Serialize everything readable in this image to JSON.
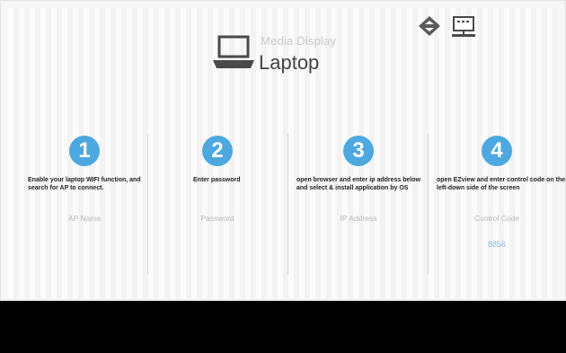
{
  "header": {
    "subtitle": "Media Display",
    "title": "Laptop",
    "icons": {
      "laptop": "laptop-icon",
      "toggle": "toggle-arrows-icon",
      "display": "network-display-icon"
    }
  },
  "steps": [
    {
      "number": "1",
      "text": "Enable your laptop WIFI function, and search for AP to connect.",
      "field": "AP Name"
    },
    {
      "number": "2",
      "text": "Enter password",
      "field": "Password"
    },
    {
      "number": "3",
      "text": "open browser and enter ip address below and select & install application by OS",
      "field": "IP Address"
    },
    {
      "number": "4",
      "text": "open EZview and enter control code on the left-down side of the screen",
      "field": "Control Code",
      "code": "8856"
    }
  ],
  "colors": {
    "accent": "#4da8e0",
    "code": "#8fbbe0",
    "bottom_bar": "#000000"
  }
}
